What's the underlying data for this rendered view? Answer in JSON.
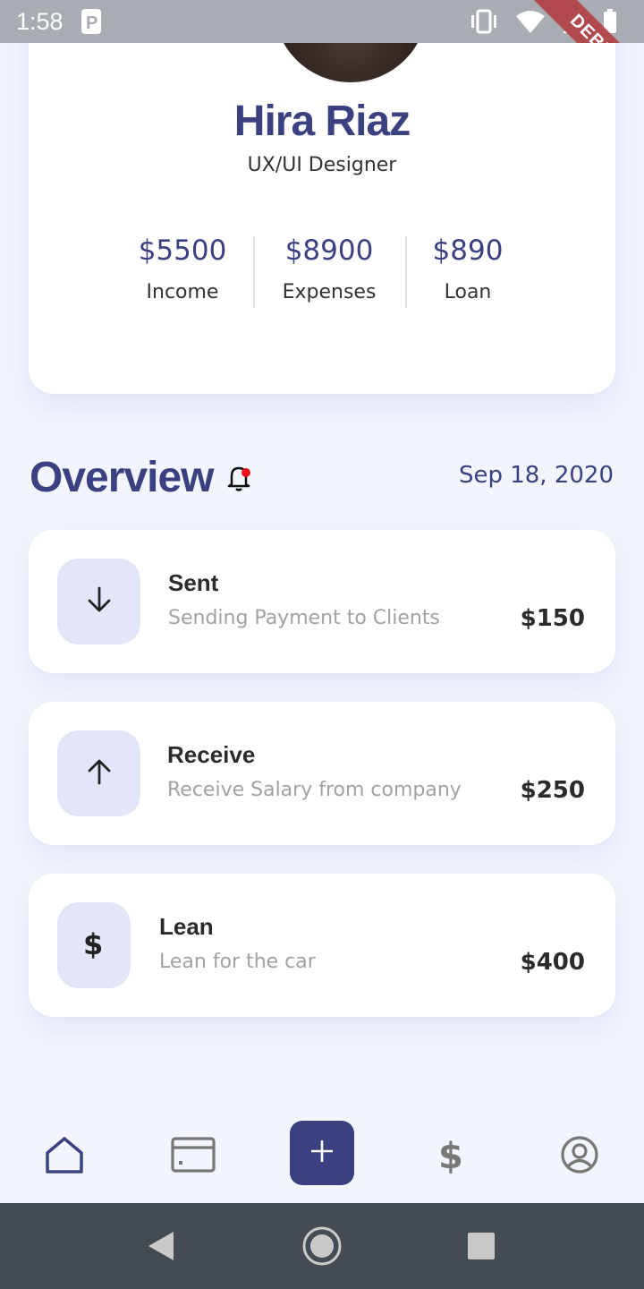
{
  "status_bar": {
    "time": "1:58",
    "debug_label": "DEBUG"
  },
  "profile": {
    "name": "Hira Riaz",
    "role": "UX/UI Designer",
    "stats": [
      {
        "value": "$5500",
        "label": "Income"
      },
      {
        "value": "$8900",
        "label": "Expenses"
      },
      {
        "value": "$890",
        "label": "Loan"
      }
    ]
  },
  "overview": {
    "title": "Overview",
    "date": "Sep 18, 2020",
    "has_notification": true
  },
  "transactions": [
    {
      "title": "Sent",
      "subtitle": "Sending Payment to Clients",
      "amount": "$150",
      "icon": "arrow-down-icon"
    },
    {
      "title": "Receive",
      "subtitle": "Receive Salary from company",
      "amount": "$250",
      "icon": "arrow-up-icon"
    },
    {
      "title": "Lean",
      "subtitle": "Lean for the car",
      "amount": "$400",
      "icon": "dollar-icon"
    }
  ],
  "bottom_nav": {
    "items": [
      "home-icon",
      "card-icon",
      "add-icon",
      "dollar-icon",
      "profile-icon"
    ],
    "active": "home-icon"
  },
  "colors": {
    "primary": "#3b4180",
    "background": "#f2f5fd",
    "icon_box": "#e3e6f7",
    "notification_dot": "#e8101a"
  }
}
